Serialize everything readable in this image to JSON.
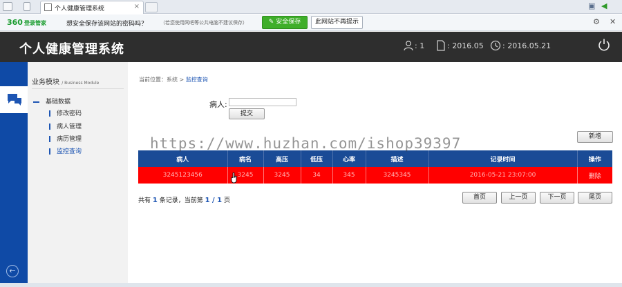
{
  "browser": {
    "tab_title": "个人健康管理系统",
    "tab_close": "×"
  },
  "password_bar": {
    "brand": "360",
    "brand_sub": "登录管家",
    "question": "想安全保存该网站的密码吗？",
    "note": "（若您使用网吧等公共电脑不建议保存）",
    "save_label": "安全保存",
    "never_label": "此网站不再提示"
  },
  "header": {
    "title": "个人健康管理系统",
    "user_count": ": 1",
    "date_short": ": 2016.05",
    "date_full": ": 2016.05.21"
  },
  "sidebar": {
    "module_title": "业务模块",
    "module_title_en": "/ Business Module",
    "group_label": "基础数据",
    "items": [
      {
        "label": "修改密码"
      },
      {
        "label": "病人管理"
      },
      {
        "label": "病历管理"
      },
      {
        "label": "监控查询"
      }
    ]
  },
  "main": {
    "breadcrumb_prefix": "当前位置：系统 > ",
    "breadcrumb_current": "监控查询",
    "patient_label": "病人:",
    "patient_value": "",
    "submit_label": "提交",
    "add_label": "新增",
    "watermark": "https://www.huzhan.com/ishop39397"
  },
  "table": {
    "headers": [
      "病人",
      "病名",
      "高压",
      "低压",
      "心率",
      "描述",
      "记录时间",
      "操作"
    ],
    "rows": [
      [
        "3245123456",
        "3245",
        "3245",
        "34",
        "345",
        "3245345",
        "2016-05-21 23:07:00",
        "删除"
      ]
    ]
  },
  "pager": {
    "prefix": "共有 ",
    "total": "1",
    "middle": " 条记录，当前第 ",
    "current": "1",
    "sep": " / ",
    "pages": "1",
    "suffix": " 页",
    "first": "首页",
    "prev": "上一页",
    "next": "下一页",
    "last": "尾页"
  }
}
